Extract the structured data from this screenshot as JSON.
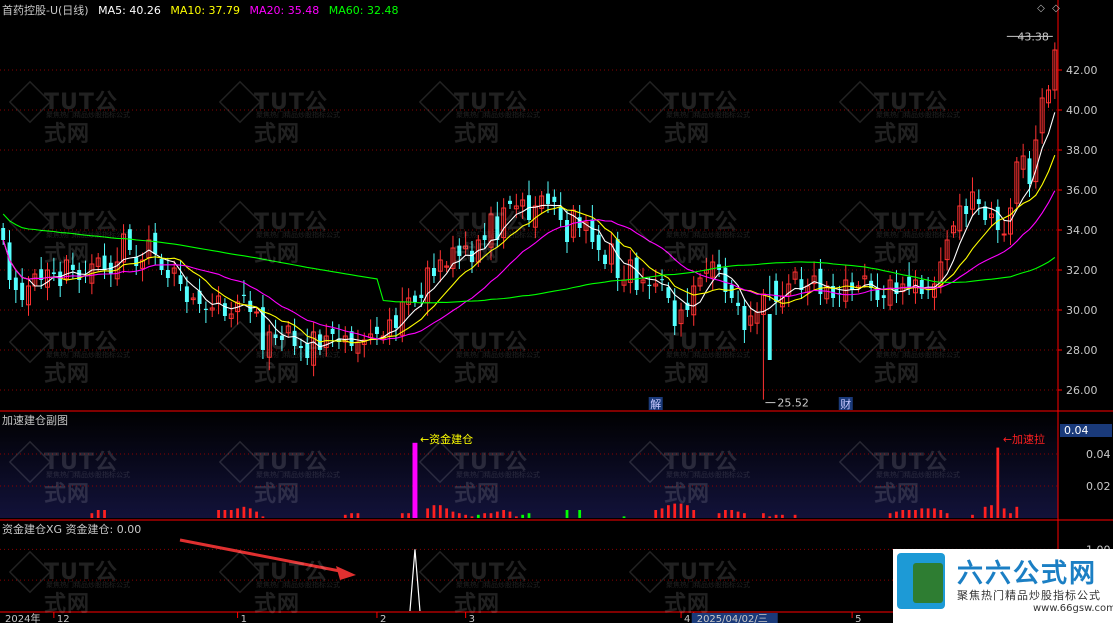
{
  "header": {
    "title": "首药控股-U(日线)",
    "ma": [
      {
        "label": "MA5: 40.26",
        "color": "#ffffff"
      },
      {
        "label": "MA10: 37.79",
        "color": "#ffff00"
      },
      {
        "label": "MA20: 35.48",
        "color": "#ff00ff"
      },
      {
        "label": "MA60: 32.48",
        "color": "#00ff00"
      }
    ],
    "buttons": [
      "◇",
      "◇"
    ]
  },
  "colors": {
    "up": "#ff3232",
    "down": "#54ffff",
    "grid": "#8b0000",
    "axis": "#ff0000",
    "ma5": "#ffffff",
    "ma10": "#ffff00",
    "ma20": "#ff00ff",
    "ma60": "#00ff00",
    "axis_text": "#c8c8c8"
  },
  "main_axis": {
    "ticks": [
      "42.00",
      "40.00",
      "38.00",
      "36.00",
      "34.00",
      "32.00",
      "30.00",
      "28.00",
      "26.00"
    ],
    "tick_values": [
      42,
      40,
      38,
      36,
      34,
      32,
      30,
      28,
      26
    ],
    "range": [
      25,
      44.5
    ]
  },
  "annotations": {
    "high": "43.38",
    "high_value": 43.38,
    "low": "25.52",
    "low_value": 25.52,
    "marker_jie": "解",
    "marker_cai": "财"
  },
  "sub1": {
    "title": "加速建仓副图",
    "label_jz": "资金建仓",
    "label_js": "加速拉",
    "current": "0.04",
    "ticks": [
      "0.04",
      "0.02"
    ],
    "tick_values": [
      0.04,
      0.02
    ],
    "range": [
      0,
      0.055
    ]
  },
  "sub2": {
    "title": "资金建仓XG  资金建仓: 0.00",
    "ticks": [
      "1.00",
      "0.50"
    ],
    "tick_values": [
      1,
      0.5
    ],
    "range": [
      0,
      1.2
    ]
  },
  "x_axis": {
    "labels": [
      {
        "text": "2024年",
        "idx": 0
      },
      {
        "text": "12",
        "idx": 8
      },
      {
        "text": "1",
        "idx": 37
      },
      {
        "text": "2",
        "idx": 59
      },
      {
        "text": "3",
        "idx": 73
      },
      {
        "text": "4",
        "idx": 107
      },
      {
        "text": "2025/04/02/三",
        "idx": 109
      },
      {
        "text": "5",
        "idx": 134
      },
      {
        "text": "6",
        "idx": 157
      }
    ],
    "period": "日线"
  },
  "watermark": {
    "text": "TUT公式网",
    "sub": "聚焦热门精品炒股指标公式"
  },
  "site_logo": {
    "title": "六六公式网",
    "subtitle": "聚焦热门精品炒股指标公式",
    "url": "www.66gsw.com"
  },
  "chart_data": {
    "type": "candlestick",
    "count": 167,
    "ohlc_note": "daily candles, values estimated from price axis",
    "close": [
      33.5,
      31.5,
      31.0,
      30.5,
      31.2,
      31.8,
      31.5,
      32.0,
      31.8,
      31.2,
      32.5,
      32.0,
      31.5,
      31.7,
      32.3,
      32.6,
      32.0,
      31.8,
      32.4,
      33.8,
      33.0,
      32.2,
      32.5,
      33.5,
      32.8,
      32.0,
      31.6,
      32.1,
      31.3,
      30.4,
      30.6,
      30.3,
      30.0,
      30.1,
      30.7,
      29.7,
      29.8,
      30.4,
      30.7,
      29.9,
      29.9,
      28.0,
      28.9,
      28.6,
      28.5,
      29.2,
      28.2,
      28.1,
      27.6,
      28.9,
      28.0,
      28.7,
      28.8,
      28.4,
      28.7,
      28.2,
      28.4,
      28.5,
      28.8,
      28.8,
      28.7,
      29.5,
      29.1,
      30.4,
      30.6,
      30.4,
      30.6,
      32.1,
      31.7,
      32.5,
      32.2,
      33.1,
      32.7,
      33.2,
      32.4,
      33.5,
      33.5,
      34.8,
      33.5,
      35.1,
      35.3,
      35.2,
      35.5,
      34.5,
      35.2,
      35.7,
      35.3,
      35.4,
      34.5,
      33.4,
      35.0,
      34.1,
      34.4,
      33.4,
      33.0,
      32.3,
      33.3,
      31.6,
      31.5,
      32.5,
      31.0,
      31.5,
      31.2,
      31.3,
      31.5,
      30.6,
      29.2,
      30.0,
      30.0,
      31.2,
      31.6,
      32.0,
      32.4,
      32.0,
      30.9,
      30.6,
      30.2,
      29.0,
      29.7,
      29.9,
      30.8,
      31.1,
      30.4,
      30.7,
      31.3,
      31.9,
      31.0,
      31.2,
      31.7,
      30.8,
      31.2,
      30.6,
      30.8,
      31.5,
      31.0,
      31.2,
      31.7,
      31.1,
      30.5,
      30.6,
      31.5,
      30.8,
      31.3,
      31.1,
      31.5,
      30.8,
      31.0,
      31.3,
      32.4,
      33.5,
      34.2,
      35.2,
      34.8,
      35.9,
      35.3,
      34.5,
      34.8,
      34.0,
      33.8,
      35.1,
      37.4,
      37.7,
      36.3,
      38.5,
      40.6,
      41.0,
      43.0
    ],
    "ma5_last": 40.26,
    "ma10_last": 37.79,
    "ma20_last": 35.48,
    "ma60_last": 32.48,
    "sub1_bars": [
      {
        "i": 14,
        "v": 0.003
      },
      {
        "i": 15,
        "v": 0.005
      },
      {
        "i": 16,
        "v": 0.005
      },
      {
        "i": 34,
        "v": 0.005
      },
      {
        "i": 35,
        "v": 0.005
      },
      {
        "i": 36,
        "v": 0.005
      },
      {
        "i": 37,
        "v": 0.006
      },
      {
        "i": 38,
        "v": 0.007
      },
      {
        "i": 39,
        "v": 0.006
      },
      {
        "i": 40,
        "v": 0.004
      },
      {
        "i": 41,
        "v": 0.001
      },
      {
        "i": 54,
        "v": 0.002
      },
      {
        "i": 55,
        "v": 0.003
      },
      {
        "i": 56,
        "v": 0.003
      },
      {
        "i": 63,
        "v": 0.003
      },
      {
        "i": 64,
        "v": 0.003
      },
      {
        "i": 65,
        "v": 0.047,
        "c": "#ff00ff"
      },
      {
        "i": 67,
        "v": 0.006
      },
      {
        "i": 68,
        "v": 0.008
      },
      {
        "i": 69,
        "v": 0.008
      },
      {
        "i": 70,
        "v": 0.006
      },
      {
        "i": 71,
        "v": 0.004
      },
      {
        "i": 72,
        "v": 0.003
      },
      {
        "i": 73,
        "v": 0.002
      },
      {
        "i": 74,
        "v": 0.001
      },
      {
        "i": 75,
        "v": 0.002,
        "c": "#00ff00"
      },
      {
        "i": 76,
        "v": 0.003
      },
      {
        "i": 77,
        "v": 0.003
      },
      {
        "i": 78,
        "v": 0.004
      },
      {
        "i": 79,
        "v": 0.005
      },
      {
        "i": 80,
        "v": 0.004
      },
      {
        "i": 81,
        "v": 0.001
      },
      {
        "i": 82,
        "v": 0.002,
        "c": "#00ff00"
      },
      {
        "i": 83,
        "v": 0.003,
        "c": "#00ff00"
      },
      {
        "i": 89,
        "v": 0.005,
        "c": "#00ff00"
      },
      {
        "i": 91,
        "v": 0.005,
        "c": "#00ff00"
      },
      {
        "i": 98,
        "v": 0.001,
        "c": "#00ff00"
      },
      {
        "i": 103,
        "v": 0.005
      },
      {
        "i": 104,
        "v": 0.006
      },
      {
        "i": 105,
        "v": 0.008
      },
      {
        "i": 106,
        "v": 0.009
      },
      {
        "i": 107,
        "v": 0.009
      },
      {
        "i": 108,
        "v": 0.008
      },
      {
        "i": 109,
        "v": 0.005
      },
      {
        "i": 113,
        "v": 0.003
      },
      {
        "i": 114,
        "v": 0.005
      },
      {
        "i": 115,
        "v": 0.005
      },
      {
        "i": 116,
        "v": 0.004
      },
      {
        "i": 117,
        "v": 0.003
      },
      {
        "i": 120,
        "v": 0.003
      },
      {
        "i": 121,
        "v": 0.001
      },
      {
        "i": 122,
        "v": 0.002
      },
      {
        "i": 123,
        "v": 0.002
      },
      {
        "i": 125,
        "v": 0.002
      },
      {
        "i": 140,
        "v": 0.003
      },
      {
        "i": 141,
        "v": 0.004
      },
      {
        "i": 142,
        "v": 0.005
      },
      {
        "i": 143,
        "v": 0.005
      },
      {
        "i": 144,
        "v": 0.005
      },
      {
        "i": 145,
        "v": 0.006
      },
      {
        "i": 146,
        "v": 0.006
      },
      {
        "i": 147,
        "v": 0.006
      },
      {
        "i": 148,
        "v": 0.005
      },
      {
        "i": 149,
        "v": 0.003
      },
      {
        "i": 153,
        "v": 0.002
      },
      {
        "i": 155,
        "v": 0.007
      },
      {
        "i": 156,
        "v": 0.008
      },
      {
        "i": 157,
        "v": 0.044
      },
      {
        "i": 158,
        "v": 0.006
      },
      {
        "i": 159,
        "v": 0.003
      },
      {
        "i": 160,
        "v": 0.007
      }
    ],
    "sub2_signal": {
      "i": 65,
      "v": 1.0
    }
  }
}
